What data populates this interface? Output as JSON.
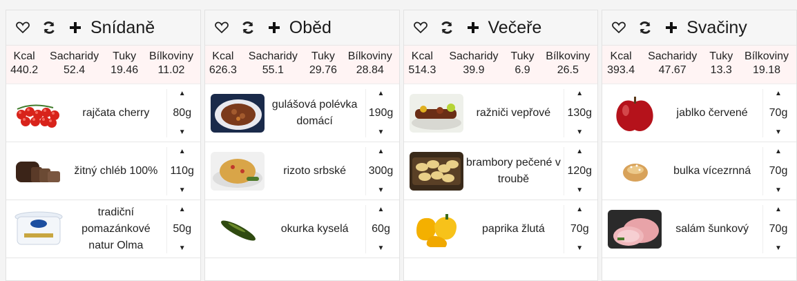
{
  "stat_headers": [
    "Kcal",
    "Sacharidy",
    "Tuky",
    "Bílkoviny"
  ],
  "meals": [
    {
      "title": "Snídaně",
      "stats": [
        "440.2",
        "52.4",
        "19.46",
        "11.02"
      ],
      "items": [
        {
          "name": "rajčata cherry",
          "amount": "80g",
          "image": "cherry-tomatoes"
        },
        {
          "name": "žitný chléb 100%",
          "amount": "110g",
          "image": "rye-bread"
        },
        {
          "name": "tradiční pomazánkové natur Olma",
          "amount": "50g",
          "image": "spread-tub"
        }
      ]
    },
    {
      "title": "Oběd",
      "stats": [
        "626.3",
        "55.1",
        "29.76",
        "28.84"
      ],
      "items": [
        {
          "name": "gulášová polévka domácí",
          "amount": "190g",
          "image": "goulash-soup"
        },
        {
          "name": "rizoto srbské",
          "amount": "300g",
          "image": "risotto"
        },
        {
          "name": "okurka kyselá",
          "amount": "60g",
          "image": "pickle"
        }
      ]
    },
    {
      "title": "Večeře",
      "stats": [
        "514.3",
        "39.9",
        "6.9",
        "26.5"
      ],
      "items": [
        {
          "name": "ražniči vepřové",
          "amount": "130g",
          "image": "skewers"
        },
        {
          "name": "brambory pečené v troubě",
          "amount": "120g",
          "image": "roast-potatoes"
        },
        {
          "name": "paprika žlutá",
          "amount": "70g",
          "image": "yellow-pepper"
        }
      ]
    },
    {
      "title": "Svačiny",
      "stats": [
        "393.4",
        "47.67",
        "13.3",
        "19.18"
      ],
      "items": [
        {
          "name": "jablko červené",
          "amount": "70g",
          "image": "red-apple"
        },
        {
          "name": "bulka vícezrnná",
          "amount": "70g",
          "image": "roll"
        },
        {
          "name": "salám šunkový",
          "amount": "70g",
          "image": "ham-salami"
        }
      ]
    }
  ],
  "icons": {
    "favorite": "heart-icon",
    "refresh": "refresh-icon",
    "add": "plus-icon",
    "increase": "arrow-up-icon",
    "decrease": "arrow-down-icon"
  },
  "colors": {
    "stats_background": "#fff4f4",
    "header_background": "#f6f6f6"
  }
}
